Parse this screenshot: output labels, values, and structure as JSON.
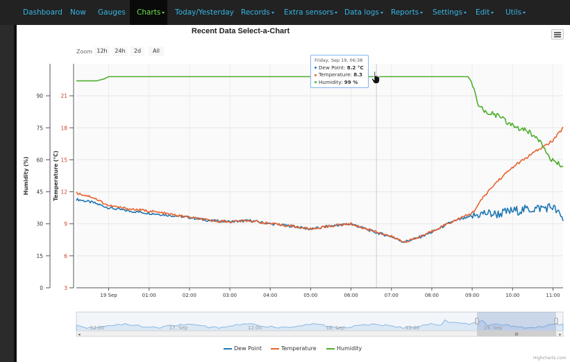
{
  "nav": {
    "items": [
      {
        "label": "Dashboard",
        "dropdown": false,
        "active": false
      },
      {
        "label": "Now",
        "dropdown": false,
        "active": false
      },
      {
        "label": "Gauges",
        "dropdown": false,
        "active": false
      },
      {
        "label": "Charts",
        "dropdown": true,
        "active": true
      },
      {
        "label": "Today/Yesterday",
        "dropdown": false,
        "active": false
      },
      {
        "label": "Records",
        "dropdown": true,
        "active": false
      },
      {
        "label": "Extra sensors",
        "dropdown": true,
        "active": false
      },
      {
        "label": "Data logs",
        "dropdown": true,
        "active": false
      },
      {
        "label": "Reports",
        "dropdown": true,
        "active": false
      },
      {
        "label": "Settings",
        "dropdown": true,
        "active": false
      },
      {
        "label": "Edit",
        "dropdown": true,
        "active": false
      },
      {
        "label": "Utils",
        "dropdown": true,
        "active": false
      }
    ],
    "color": "#35b5e5",
    "active_color": "#6de04a"
  },
  "zoom": {
    "label": "Zoom",
    "buttons": [
      "12h",
      "24h",
      "2d",
      "All"
    ]
  },
  "tooltip": {
    "header": "Friday, Sep 19, 06:38",
    "rows": [
      {
        "name": "Dew Point",
        "value": "8.2 °C",
        "color": "#1f77b4"
      },
      {
        "name": "Temperature",
        "value": "8.3",
        "color": "#e8622c"
      },
      {
        "name": "Humidity",
        "value": "99 %",
        "color": "#4cae2c"
      }
    ]
  },
  "credits": "Highcharts.com",
  "navigator": {
    "labels": [
      "12:00",
      "17. Sep",
      "12:00",
      "18. Sep",
      "12:00",
      "19. Sep"
    ],
    "scroll_icon": "III"
  },
  "chart_data": {
    "type": "line",
    "title": "Recent Data Select-a-Chart",
    "xlabel": "",
    "x_ticks": [
      "19 Sep",
      "01:00",
      "02:00",
      "03:00",
      "04:00",
      "05:00",
      "06:00",
      "07:00",
      "08:00",
      "09:00",
      "10:00",
      "11:00"
    ],
    "y_axes": [
      {
        "label": "Humidity (%)",
        "ticks": [
          "0",
          "15",
          "30",
          "45",
          "60",
          "75",
          "90"
        ],
        "range": [
          0,
          105
        ]
      },
      {
        "label": "Temperature (°C)",
        "ticks": [
          "3",
          "6",
          "9",
          "12",
          "15",
          "18",
          "21"
        ],
        "range": [
          3,
          24
        ],
        "tick_color": "#d33a2c"
      }
    ],
    "grid": true,
    "legend_position": "bottom-center",
    "x_hours": [
      -0.8,
      0,
      1,
      2,
      3,
      4,
      5,
      6,
      7,
      8,
      9,
      10,
      11,
      11.25
    ],
    "series": [
      {
        "name": "Dew Point",
        "color": "#1f77b4",
        "axis": "temperature",
        "x": [
          -0.8,
          -0.4,
          0,
          0.5,
          1,
          1.5,
          2,
          2.5,
          3,
          3.5,
          4,
          4.5,
          5,
          5.5,
          6,
          6.3,
          6.6,
          7,
          7.3,
          7.6,
          8,
          8.5,
          9,
          9.3,
          9.6,
          10,
          10.5,
          11,
          11.25
        ],
        "y": [
          11.3,
          11.0,
          10.5,
          10.2,
          10.0,
          9.8,
          9.6,
          9.3,
          9.2,
          9.3,
          9.0,
          8.8,
          8.5,
          8.8,
          9.0,
          8.6,
          8.2,
          7.8,
          7.3,
          7.6,
          8.2,
          9.2,
          9.7,
          10.0,
          9.9,
          10.2,
          10.4,
          10.6,
          9.4
        ]
      },
      {
        "name": "Temperature",
        "color": "#e8622c",
        "axis": "temperature",
        "x": [
          -0.8,
          -0.4,
          0,
          0.5,
          1,
          1.5,
          2,
          2.5,
          3,
          3.5,
          4,
          4.5,
          5,
          5.5,
          6,
          6.3,
          6.6,
          7,
          7.3,
          7.6,
          8,
          8.5,
          9,
          9.3,
          9.6,
          10,
          10.5,
          11,
          11.25
        ],
        "y": [
          11.9,
          11.5,
          10.7,
          10.4,
          10.2,
          9.9,
          9.6,
          9.3,
          9.2,
          9.3,
          9.0,
          8.8,
          8.5,
          8.8,
          9.0,
          8.6,
          8.3,
          7.8,
          7.3,
          7.6,
          8.3,
          9.2,
          10.0,
          11.6,
          12.9,
          14.3,
          15.6,
          16.8,
          18.0
        ]
      },
      {
        "name": "Humidity",
        "color": "#4cae2c",
        "axis": "humidity",
        "x": [
          -0.8,
          -0.3,
          -0.1,
          0,
          1,
          2,
          3,
          4,
          5,
          6,
          7,
          8,
          8.9,
          9.0,
          9.15,
          9.3,
          9.6,
          10,
          10.4,
          10.7,
          11,
          11.25
        ],
        "y": [
          97,
          97,
          98,
          99,
          99,
          99,
          99,
          99,
          99,
          99,
          99,
          99,
          99,
          96,
          85,
          83,
          81,
          76,
          73,
          69,
          59,
          57
        ]
      }
    ]
  }
}
